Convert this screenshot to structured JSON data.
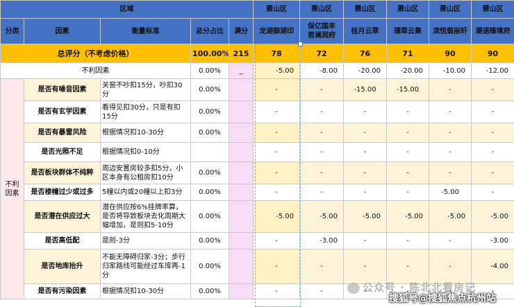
{
  "header": {
    "region_label": "区域",
    "regions": [
      "萧山区",
      "萧山区",
      "萧山区",
      "萧山区",
      "萧山区",
      "萧山区"
    ],
    "columns": {
      "category": "分类",
      "factor": "因素",
      "criteria": "衡量标准",
      "total_pct": "总分占比",
      "full_score": "满分"
    },
    "projects": [
      {
        "line1": "龙湖御湖印",
        "line2": ""
      },
      {
        "line1": "保亿国丰",
        "line2": "君澜润府"
      },
      {
        "line1": "桂月云翠",
        "line2": ""
      },
      {
        "line1": "璞翠云集",
        "line2": ""
      },
      {
        "line1": "滨悦翡丽轩",
        "line2": ""
      },
      {
        "line1": "潮语臻境府",
        "line2": ""
      }
    ]
  },
  "total_row": {
    "label": "总评分（不考虑价格）",
    "pct": "100.00%",
    "full": "215",
    "scores": [
      "78",
      "72",
      "76",
      "71",
      "90",
      "90"
    ]
  },
  "negative_row": {
    "label": "不利因素",
    "pct": "0.00%",
    "full": "_",
    "scores": [
      "-5.00",
      "-8.00",
      "-20.00",
      "-20.00",
      "-10.00",
      "-12.00"
    ]
  },
  "category_label": "不利\n因素",
  "rows": [
    {
      "factor": "是否有噪音因素",
      "criteria": "关窗不吵扣15分，吵扣30分",
      "pct": "0.00%",
      "full": "",
      "scores": [
        "-",
        "-",
        "-15.00",
        "-15.00",
        "-",
        "-"
      ]
    },
    {
      "factor": "是否有玄学因素",
      "criteria": "看得见扣30分，只是有扣15分",
      "pct": "0.00%",
      "full": "",
      "scores": [
        "-",
        "-",
        "-",
        "-",
        "-",
        "-"
      ]
    },
    {
      "factor": "是否有暴雷风险",
      "criteria": "根据情况扣10-30分",
      "pct": "0.00%",
      "full": "",
      "scores": [
        "-",
        "-",
        "-",
        "-",
        "-",
        "-"
      ]
    },
    {
      "factor": "是否光照不足",
      "criteria": "根据情况扣0-10分",
      "pct": "",
      "full": "",
      "scores": [
        "-",
        "-",
        "-",
        "-",
        "-",
        "-"
      ]
    },
    {
      "factor": "是否板块群体不纯粹",
      "criteria": "周边安置房较多扣5分，小区本身有公租房扣10分",
      "pct": "0.00%",
      "full": "",
      "scores": [
        "-",
        "-",
        "-",
        "-",
        "-",
        "-"
      ]
    },
    {
      "factor": "是否楼幢过少或过多",
      "criteria": "5幢以内或20幢以上扣3分",
      "pct": "0.00%",
      "full": "",
      "scores": [
        "-",
        "-",
        "-",
        "-",
        "-5.00",
        "-"
      ]
    },
    {
      "factor": "是否潜在供应过大",
      "criteria": "潜在供应按6%挂牌率算，是否将导致板块去化周期大幅增加，是则扣5-10分",
      "pct": "0.00%",
      "full": "",
      "scores": [
        "-5.00",
        "-5.00",
        "-5.00",
        "-5.00",
        "-5.00",
        "-5.00"
      ]
    },
    {
      "factor": "是否高低配",
      "criteria": "是则-3分",
      "pct": "0.00%",
      "full": "",
      "scores": [
        "-",
        "-3.00",
        "-",
        "-",
        "-",
        "-3.00"
      ]
    },
    {
      "factor": "是否地库抬升",
      "criteria": "不能无障碍归家-3分；步行归家路线可能经过车库再-1分",
      "pct": "0.00%",
      "full": "",
      "scores": [
        "-",
        "-",
        "-",
        "-",
        "-",
        "-4.00"
      ]
    },
    {
      "factor": "是否有污染因素",
      "criteria": "根据情况扣10-30分",
      "pct": "0.00%",
      "full": "",
      "scores": [
        "-",
        "-",
        "-",
        "-",
        "-",
        "-"
      ]
    }
  ],
  "watermarks": {
    "wechat": "公众号 · 陈北北看房记",
    "sohu": "搜狐号@搜狐焦点杭州站"
  },
  "colors": {
    "header_blue": "#4472c4",
    "total_orange": "#ffc000",
    "factor_cream": "#fdf3d8",
    "score_pink": "#f6ddf5",
    "category_pink": "#fde9e7"
  }
}
